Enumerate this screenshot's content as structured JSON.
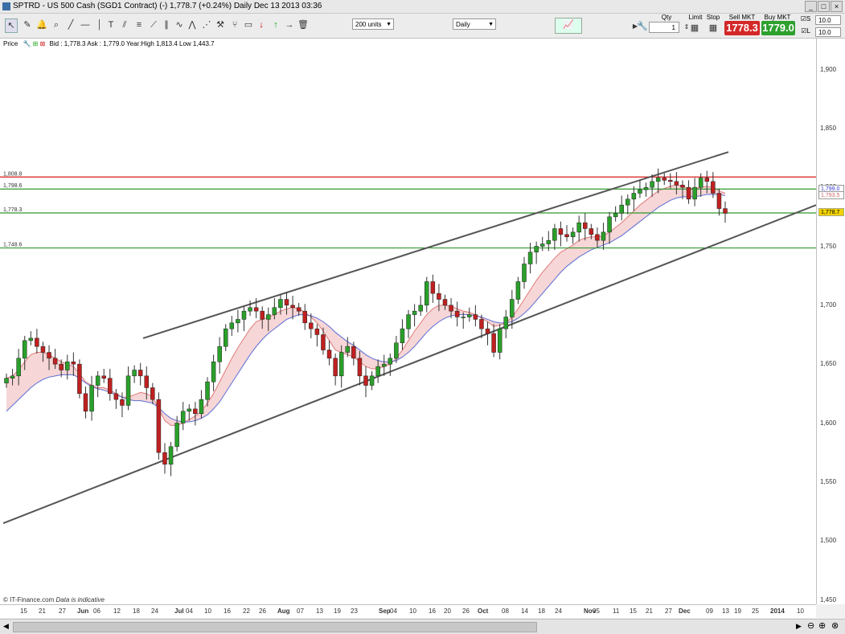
{
  "window": {
    "title": "SPTRD - US 500 Cash (SGD1 Contract) (-)    1,778.7 (+0.24%)    Daily  Dec 13 2013 03:36"
  },
  "toolbar": {
    "units_select": "200 units",
    "period_select": "Daily"
  },
  "trade": {
    "qty_label": "Qty",
    "qty_value": "1",
    "limit_label": "Limit",
    "stop_label": "Stop",
    "sell_label": "Sell MKT",
    "sell_price": "1778.3",
    "buy_label": "Buy MKT",
    "buy_price": "1779.0",
    "s_label": "S",
    "s_value": "10.0",
    "l_label": "L",
    "l_value": "10.0"
  },
  "info": {
    "price_label": "Price",
    "quote": "Bid : 1,778.3 Ask : 1,779.0 Year:High 1,813.4 Low 1,443.7"
  },
  "chart_data": {
    "type": "candlestick",
    "ylim": [
      1440,
      1920
    ],
    "y_ticks": [
      "1,900",
      "1,850",
      "1,800",
      "1,750",
      "1,700",
      "1,650",
      "1,600",
      "1,550",
      "1,500",
      "1,450"
    ],
    "x_ticks": [
      "15",
      "21",
      "27",
      "Jun",
      "06",
      "12",
      "18",
      "24",
      "Jul",
      "04",
      "10",
      "16",
      "22",
      "26",
      "Aug",
      "07",
      "13",
      "19",
      "23",
      "Sep",
      "04",
      "10",
      "16",
      "20",
      "26",
      "Oct",
      "08",
      "14",
      "18",
      "24",
      "Nov",
      "05",
      "11",
      "15",
      "21",
      "27",
      "Dec",
      "09",
      "13",
      "19",
      "25",
      "2014",
      "10"
    ],
    "levels": [
      {
        "value": "1,808.8",
        "color": "#d81818"
      },
      {
        "value": "1,798.6",
        "color": "#2e9a2e"
      },
      {
        "value": "1,778.3",
        "color": "#2e9a2e"
      },
      {
        "value": "1,748.6",
        "color": "#2e9a2e"
      }
    ],
    "last_price": "1,778.7",
    "ma_fast": "1,799.0",
    "ma_slow": "1,793.5",
    "channel_upper": [
      [
        1700,
        1672
      ],
      [
        1825,
        1830
      ]
    ],
    "channel_lower": [
      [
        1515,
        1515
      ],
      [
        1700,
        1720
      ],
      [
        1755,
        1785
      ]
    ],
    "closes": [
      1638,
      1640,
      1655,
      1670,
      1672,
      1665,
      1660,
      1655,
      1650,
      1645,
      1652,
      1650,
      1625,
      1610,
      1632,
      1640,
      1638,
      1625,
      1620,
      1615,
      1640,
      1645,
      1640,
      1630,
      1620,
      1575,
      1565,
      1580,
      1600,
      1610,
      1612,
      1608,
      1620,
      1635,
      1652,
      1665,
      1680,
      1685,
      1688,
      1695,
      1698,
      1695,
      1688,
      1692,
      1698,
      1705,
      1700,
      1698,
      1695,
      1685,
      1680,
      1675,
      1662,
      1655,
      1640,
      1660,
      1665,
      1655,
      1640,
      1632,
      1640,
      1648,
      1650,
      1655,
      1668,
      1680,
      1692,
      1695,
      1700,
      1720,
      1710,
      1705,
      1700,
      1695,
      1690,
      1690,
      1692,
      1688,
      1680,
      1676,
      1660,
      1680,
      1690,
      1705,
      1720,
      1735,
      1745,
      1750,
      1752,
      1755,
      1765,
      1760,
      1758,
      1762,
      1770,
      1765,
      1760,
      1755,
      1762,
      1775,
      1778,
      1785,
      1790,
      1795,
      1798,
      1800,
      1805,
      1808,
      1806,
      1805,
      1802,
      1800,
      1790,
      1800,
      1808,
      1805,
      1795,
      1782,
      1778
    ],
    "ma_fast_series": [
      1638,
      1640,
      1645,
      1652,
      1658,
      1660,
      1660,
      1658,
      1655,
      1652,
      1650,
      1648,
      1642,
      1635,
      1632,
      1630,
      1630,
      1628,
      1625,
      1622,
      1622,
      1624,
      1626,
      1625,
      1622,
      1612,
      1602,
      1598,
      1598,
      1600,
      1603,
      1606,
      1610,
      1617,
      1625,
      1635,
      1645,
      1655,
      1664,
      1672,
      1680,
      1686,
      1688,
      1690,
      1692,
      1695,
      1697,
      1698,
      1697,
      1694,
      1690,
      1685,
      1678,
      1670,
      1662,
      1660,
      1658,
      1656,
      1652,
      1648,
      1646,
      1646,
      1648,
      1650,
      1655,
      1662,
      1670,
      1678,
      1685,
      1692,
      1697,
      1700,
      1700,
      1699,
      1697,
      1695,
      1694,
      1692,
      1689,
      1686,
      1682,
      1683,
      1685,
      1690,
      1697,
      1705,
      1713,
      1721,
      1728,
      1734,
      1740,
      1745,
      1748,
      1751,
      1755,
      1757,
      1758,
      1758,
      1759,
      1762,
      1766,
      1770,
      1775,
      1780,
      1785,
      1789,
      1793,
      1797,
      1799,
      1801,
      1802,
      1801,
      1799,
      1799,
      1800,
      1801,
      1800,
      1797,
      1795
    ],
    "ma_slow_series": [
      1610,
      1615,
      1620,
      1625,
      1630,
      1634,
      1637,
      1639,
      1640,
      1641,
      1641,
      1641,
      1638,
      1634,
      1631,
      1629,
      1628,
      1626,
      1624,
      1622,
      1620,
      1619,
      1619,
      1618,
      1617,
      1613,
      1608,
      1604,
      1602,
      1601,
      1601,
      1602,
      1604,
      1607,
      1612,
      1618,
      1626,
      1634,
      1642,
      1650,
      1658,
      1665,
      1671,
      1676,
      1680,
      1684,
      1688,
      1690,
      1692,
      1692,
      1691,
      1689,
      1686,
      1682,
      1677,
      1673,
      1669,
      1666,
      1662,
      1658,
      1655,
      1653,
      1652,
      1652,
      1653,
      1656,
      1660,
      1665,
      1671,
      1677,
      1682,
      1686,
      1689,
      1691,
      1692,
      1692,
      1692,
      1691,
      1690,
      1688,
      1686,
      1685,
      1685,
      1686,
      1689,
      1693,
      1698,
      1704,
      1710,
      1716,
      1722,
      1728,
      1733,
      1737,
      1741,
      1744,
      1747,
      1749,
      1751,
      1753,
      1756,
      1759,
      1763,
      1767,
      1771,
      1775,
      1779,
      1783,
      1786,
      1789,
      1791,
      1792,
      1792,
      1792,
      1793,
      1794,
      1794,
      1794,
      1793
    ]
  },
  "footer": {
    "copyright": "© IT-Finance.com",
    "note": "Data is indicative"
  }
}
